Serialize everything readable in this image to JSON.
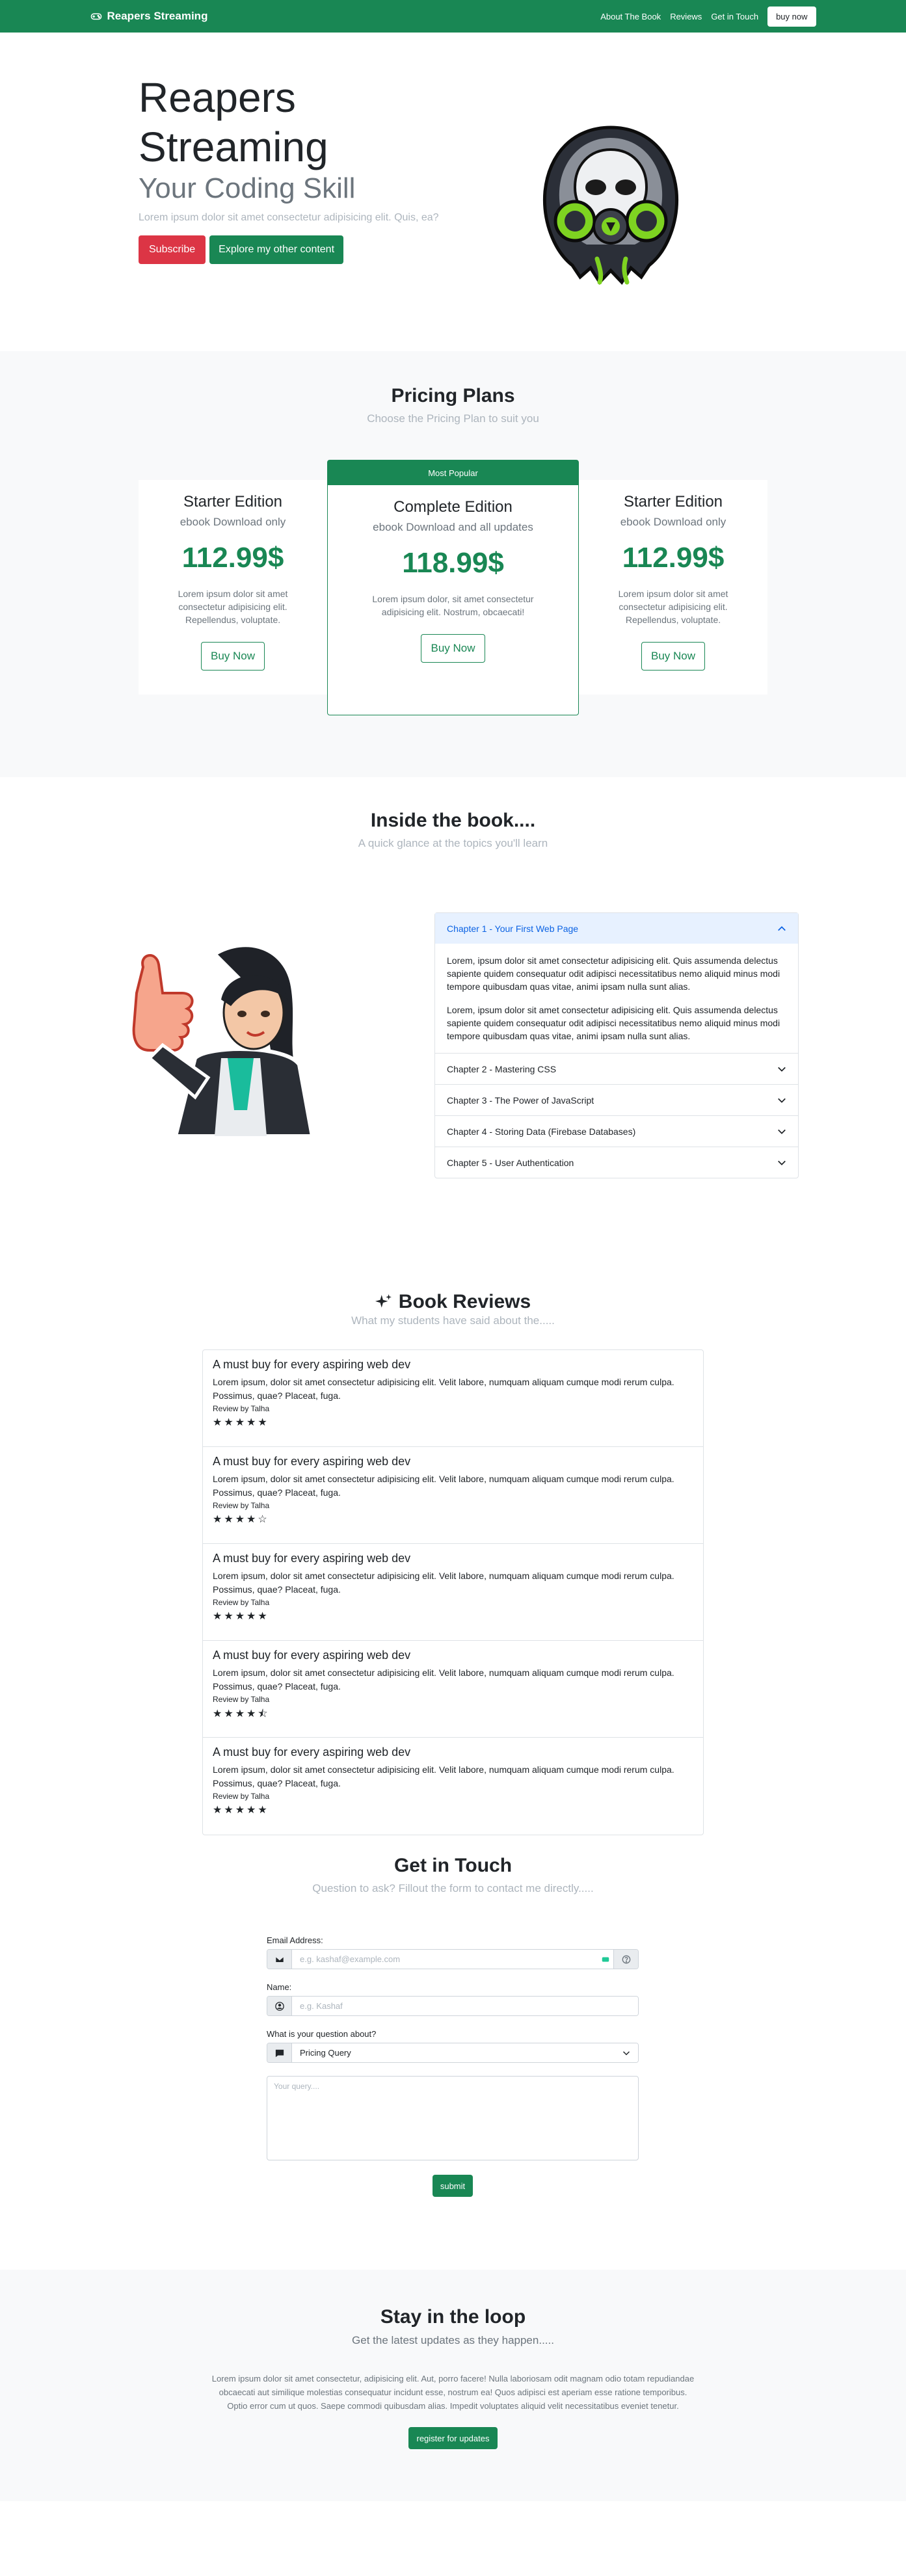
{
  "nav": {
    "brand": "Reapers Streaming",
    "links": [
      "About The Book",
      "Reviews",
      "Get in Touch"
    ],
    "buy": "buy now"
  },
  "hero": {
    "title_line1": "Reapers",
    "title_line2": "Streaming",
    "subtitle": "Your Coding Skill",
    "lead": "Lorem ipsum dolor sit amet consectetur adipisicing elit. Quis, ea?",
    "btn_subscribe": "Subscribe",
    "btn_explore": "Explore my other content"
  },
  "pricing": {
    "title": "Pricing Plans",
    "subtitle": "Choose the Pricing Plan to suit you",
    "plans": [
      {
        "name": "Starter Edition",
        "desc": "ebook Download only",
        "price": "112.99$",
        "text": "Lorem ipsum dolor sit amet consectetur adipisicing elit. Repellendus, voluptate.",
        "btn": "Buy Now"
      },
      {
        "badge": "Most Popular",
        "name": "Complete Edition",
        "desc": "ebook Download and all updates",
        "price": "118.99$",
        "text": "Lorem ipsum dolor, sit amet consectetur adipisicing elit. Nostrum, obcaecati!",
        "btn": "Buy Now"
      },
      {
        "name": "Starter Edition",
        "desc": "ebook Download only",
        "price": "112.99$",
        "text": "Lorem ipsum dolor sit amet consectetur adipisicing elit. Repellendus, voluptate.",
        "btn": "Buy Now"
      }
    ]
  },
  "book": {
    "title": "Inside the book....",
    "subtitle": "A quick glance at the topics you'll learn",
    "chapters": [
      "Chapter 1 - Your First Web Page",
      "Chapter 2 - Mastering CSS",
      "Chapter 3 - The Power of JavaScript",
      "Chapter 4 - Storing Data (Firebase Databases)",
      "Chapter 5 - User Authentication"
    ],
    "chapter1_body": [
      "Lorem, ipsum dolor sit amet consectetur adipisicing elit. Quis assumenda delectus sapiente quidem consequatur odit adipisci necessitatibus nemo aliquid minus modi tempore quibusdam quas vitae, animi ipsam nulla sunt alias.",
      "Lorem, ipsum dolor sit amet consectetur adipisicing elit. Quis assumenda delectus sapiente quidem consequatur odit adipisci necessitatibus nemo aliquid minus modi tempore quibusdam quas vitae, animi ipsam nulla sunt alias."
    ]
  },
  "reviews": {
    "title": "Book Reviews",
    "subtitle": "What my students have said about the.....",
    "items": [
      {
        "title": "A must buy for every aspiring web dev",
        "text": "Lorem ipsum, dolor sit amet consectetur adipisicing elit. Velit labore, numquam aliquam cumque modi rerum culpa. Possimus, quae? Placeat, fuga.",
        "by": "Review by Talha",
        "stars": "★★★★★"
      },
      {
        "title": "A must buy for every aspiring web dev",
        "text": "Lorem ipsum, dolor sit amet consectetur adipisicing elit. Velit labore, numquam aliquam cumque modi rerum culpa. Possimus, quae? Placeat, fuga.",
        "by": "Review by Talha",
        "stars": "★★★★☆"
      },
      {
        "title": "A must buy for every aspiring web dev",
        "text": "Lorem ipsum, dolor sit amet consectetur adipisicing elit. Velit labore, numquam aliquam cumque modi rerum culpa. Possimus, quae? Placeat, fuga.",
        "by": "Review by Talha",
        "stars": "★★★★★"
      },
      {
        "title": "A must buy for every aspiring web dev",
        "text": "Lorem ipsum, dolor sit amet consectetur adipisicing elit. Velit labore, numquam aliquam cumque modi rerum culpa. Possimus, quae? Placeat, fuga.",
        "by": "Review by Talha",
        "stars": "★★★★⯪"
      },
      {
        "title": "A must buy for every aspiring web dev",
        "text": "Lorem ipsum, dolor sit amet consectetur adipisicing elit. Velit labore, numquam aliquam cumque modi rerum culpa. Possimus, quae? Placeat, fuga.",
        "by": "Review by Talha",
        "stars": "★★★★★"
      }
    ]
  },
  "contact": {
    "title": "Get in Touch",
    "subtitle": "Question to ask? Fillout the form to contact me directly.....",
    "email_label": "Email Address:",
    "email_placeholder": "e.g. kashaf@example.com",
    "name_label": "Name:",
    "name_placeholder": "e.g. Kashaf",
    "question_label": "What is your question about?",
    "question_value": "Pricing Query",
    "query_placeholder": "Your query....",
    "submit": "submit"
  },
  "loop": {
    "title": "Stay in the loop",
    "subtitle": "Get the latest updates as they happen.....",
    "text": "Lorem ipsum dolor sit amet consectetur, adipisicing elit. Aut, porro facere! Nulla laboriosam odit magnam odio totam repudiandae obcaecati aut similique molestias consequatur incidunt esse, nostrum ea! Quos adipisci est aperiam esse ratione temporibus. Optio error cum ut quos. Saepe commodi quibusdam alias. Impedit voluptates aliquid velit necessitatibus eveniet tenetur.",
    "btn": "register for updates"
  },
  "colors": {
    "primary": "#198754",
    "danger": "#dc3545",
    "light": "#f8f9fa",
    "accordion_active": "#e7f1ff"
  }
}
